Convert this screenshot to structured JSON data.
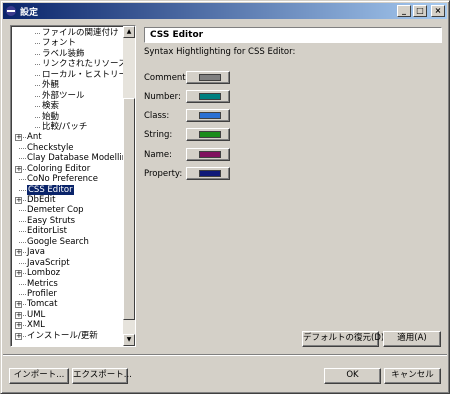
{
  "window": {
    "title": "設定",
    "minimize_glyph": "_",
    "maximize_glyph": "□",
    "close_glyph": "×"
  },
  "tree": {
    "items": [
      {
        "label": "ファイルの関連付け",
        "kind": "child"
      },
      {
        "label": "フォント",
        "kind": "child"
      },
      {
        "label": "ラベル装飾",
        "kind": "child"
      },
      {
        "label": "リンクされたリソース",
        "kind": "child"
      },
      {
        "label": "ローカル・ヒストリー",
        "kind": "child"
      },
      {
        "label": "外観",
        "kind": "child"
      },
      {
        "label": "外部ツール",
        "kind": "child"
      },
      {
        "label": "検索",
        "kind": "child"
      },
      {
        "label": "始動",
        "kind": "child"
      },
      {
        "label": "比較/パッチ",
        "kind": "child"
      },
      {
        "label": "Ant",
        "kind": "expandable"
      },
      {
        "label": "Checkstyle",
        "kind": "leaf"
      },
      {
        "label": "Clay Database Modelling",
        "kind": "leaf"
      },
      {
        "label": "Coloring Editor",
        "kind": "expandable"
      },
      {
        "label": "CoNo Preference",
        "kind": "leaf"
      },
      {
        "label": "CSS Editor",
        "kind": "leaf",
        "selected": true
      },
      {
        "label": "DbEdit",
        "kind": "expandable"
      },
      {
        "label": "Demeter Cop",
        "kind": "leaf"
      },
      {
        "label": "Easy Struts",
        "kind": "leaf"
      },
      {
        "label": "EditorList",
        "kind": "leaf"
      },
      {
        "label": "Google Search",
        "kind": "leaf"
      },
      {
        "label": "Java",
        "kind": "expandable"
      },
      {
        "label": "JavaScript",
        "kind": "leaf"
      },
      {
        "label": "Lomboz",
        "kind": "expandable"
      },
      {
        "label": "Metrics",
        "kind": "leaf"
      },
      {
        "label": "Profiler",
        "kind": "leaf"
      },
      {
        "label": "Tomcat",
        "kind": "expandable"
      },
      {
        "label": "UML",
        "kind": "expandable"
      },
      {
        "label": "XML",
        "kind": "expandable"
      },
      {
        "label": "インストール/更新",
        "kind": "expandable"
      }
    ],
    "scroll_up_glyph": "▲",
    "scroll_down_glyph": "▼",
    "expander_glyph": "+"
  },
  "page": {
    "title": "CSS Editor",
    "description": "Syntax Hightlighting for CSS Editor:",
    "colors": [
      {
        "label": "Comment:",
        "color": "#808080"
      },
      {
        "label": "Number:",
        "color": "#008080"
      },
      {
        "label": "Class:",
        "color": "#2a6fd1"
      },
      {
        "label": "String:",
        "color": "#1a8c1a"
      },
      {
        "label": "Name:",
        "color": "#80105e"
      },
      {
        "label": "Property:",
        "color": "#101a78"
      }
    ],
    "restore_defaults_label": "デフォルトの復元(D)",
    "apply_label": "適用(A)"
  },
  "footer": {
    "import_label": "インポート...",
    "export_label": "エクスポート...",
    "ok_label": "OK",
    "cancel_label": "キャンセル"
  }
}
